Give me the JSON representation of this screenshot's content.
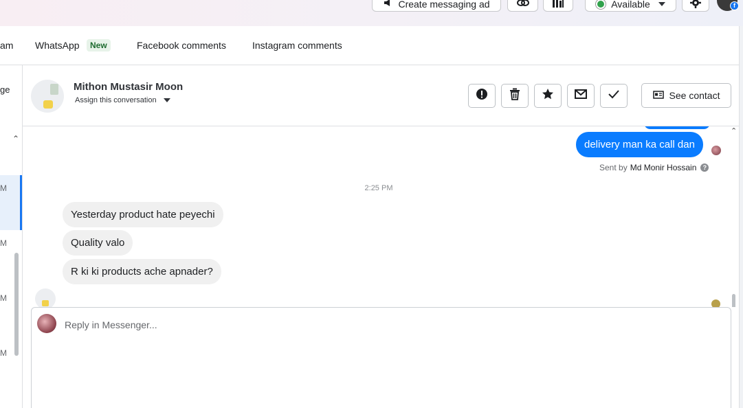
{
  "topbar": {
    "create_ad_label": "Create messaging ad",
    "availability_label": "Available"
  },
  "tabs": {
    "partial_label": "am",
    "whatsapp_label": "WhatsApp",
    "whatsapp_badge": "New",
    "facebook_label": "Facebook comments",
    "instagram_label": "Instagram comments"
  },
  "leftstrip": {
    "fragment_1": "ge",
    "fragment_2": "M",
    "fragment_3": "M",
    "fragment_4": "M",
    "fragment_5": "M"
  },
  "conversation": {
    "contact_name": "Mithon Mustasir Moon",
    "assign_label": "Assign this conversation",
    "see_contact_label": "See contact"
  },
  "messages": {
    "outgoing_text": "delivery man ka call dan",
    "sent_by_prefix": "Sent by",
    "sent_by_name": "Md Monir Hossain",
    "timestamp": "2:25 PM",
    "incoming": [
      "Yesterday product hate peyechi",
      "Quality valo",
      "R ki ki products ache apnader?"
    ]
  },
  "composer": {
    "placeholder": "Reply in Messenger..."
  },
  "colors": {
    "accent": "#0a7cff",
    "status_available": "#31a24c"
  }
}
